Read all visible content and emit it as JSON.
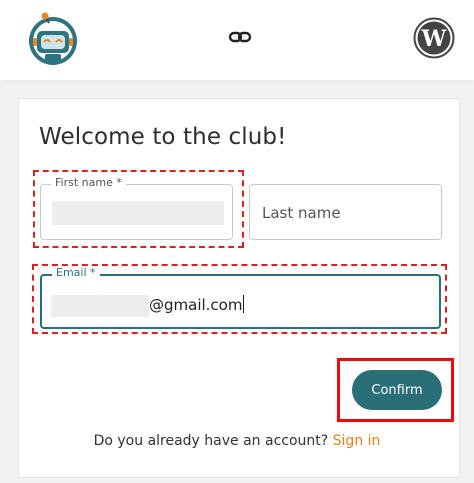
{
  "header": {
    "logo_icon": "robot-logo-icon",
    "link_icon": "link-icon",
    "wordpress_icon": "wordpress-icon"
  },
  "form": {
    "title": "Welcome to the club!",
    "first_name_label": "First name *",
    "last_name_placeholder": "Last name",
    "email_label": "Email *",
    "email_visible_value": "@gmail.com",
    "confirm_label": "Confirm",
    "account_prompt": "Do you already have an account?",
    "sign_in_label": "Sign in"
  },
  "colors": {
    "accent": "#2a6e78",
    "sign_in": "#e3821a",
    "annotation_red": "#e02020"
  }
}
